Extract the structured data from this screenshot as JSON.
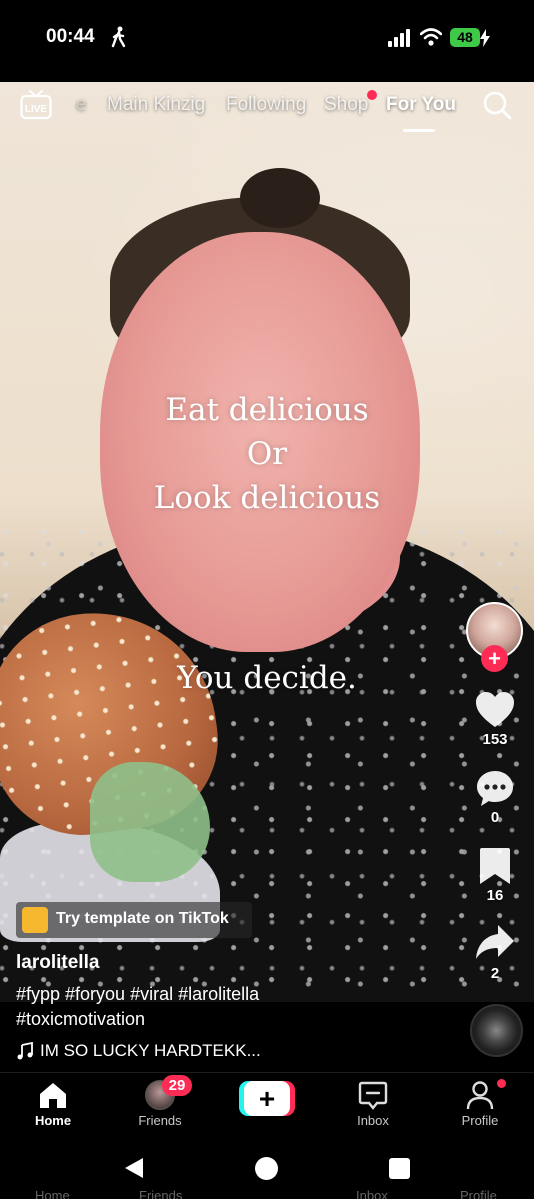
{
  "status_bar": {
    "time": "00:44",
    "battery": "48"
  },
  "top_nav": {
    "live_label": "LIVE",
    "tabs": [
      {
        "label": "e",
        "state": "faded"
      },
      {
        "label": "Main Kinzig",
        "state": "inactive"
      },
      {
        "label": "Following",
        "state": "inactive"
      },
      {
        "label": "Shop",
        "state": "inactive",
        "has_dot": true
      },
      {
        "label": "For You",
        "state": "active"
      }
    ]
  },
  "video": {
    "caption_lines": [
      "Eat delicious",
      "Or",
      "Look delicious",
      "You decide."
    ]
  },
  "actions": {
    "likes": "153",
    "comments": "0",
    "saves": "16",
    "shares": "2"
  },
  "post": {
    "template_label": "Try template on TikTok",
    "username": "larolitella",
    "hashtags_line1": "#fypp #foryou #viral #larolitella",
    "hashtags_line2": "#toxicmotivation",
    "music": "IM SO LUCKY HARDTEKK..."
  },
  "tab_bar": {
    "home": "Home",
    "friends": "Friends",
    "friends_badge": "29",
    "create": "+",
    "inbox": "Inbox",
    "profile": "Profile"
  },
  "ghost_labels": [
    "Home",
    "Friends",
    "Inbox",
    "Profile"
  ],
  "colors": {
    "accent_red": "#fe2c55",
    "accent_cyan": "#25f4ee",
    "battery_green": "#3ec947"
  }
}
